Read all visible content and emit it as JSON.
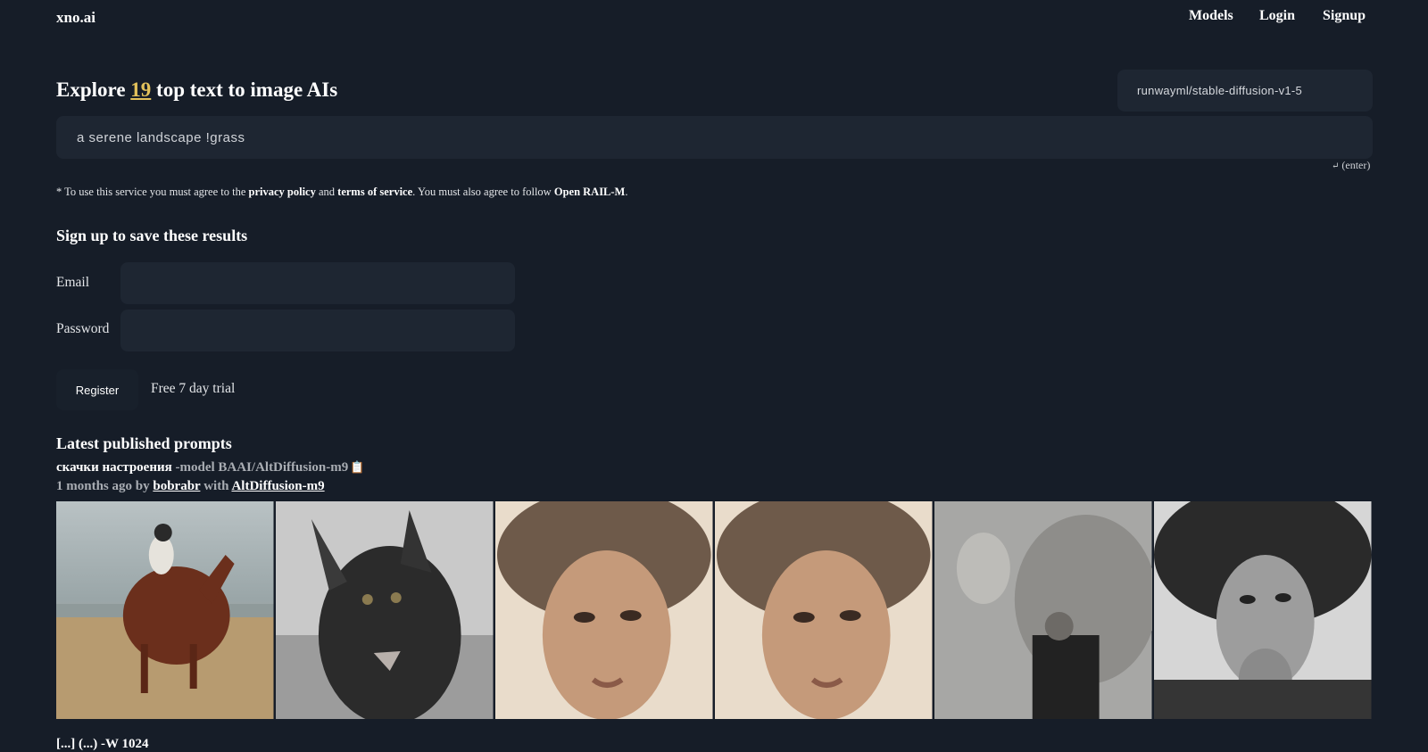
{
  "header": {
    "logo": "xno.ai",
    "nav": [
      "Models",
      "Login",
      "Signup"
    ]
  },
  "hero": {
    "explore_prefix": "Explore ",
    "model_count": "19",
    "explore_suffix": " top text to image AIs",
    "model_select_value": "runwayml/stable-diffusion-v1-5",
    "prompt_value": "a serene landscape !grass",
    "enter_hint": "(enter)"
  },
  "terms": {
    "t1": "* To use this service you must agree to the ",
    "privacy": "privacy policy",
    "t2": " and ",
    "tos": "terms of service",
    "t3": ". You must also agree to follow ",
    "rail": "Open RAIL-M",
    "t4": "."
  },
  "signup": {
    "title": "Sign up to save these results",
    "email_label": "Email",
    "password_label": "Password",
    "register_label": "Register",
    "trial_text": "Free 7 day trial"
  },
  "latest": {
    "title": "Latest published prompts",
    "prompt_text": "скачки настроения",
    "prompt_model": " -model BAAI/AltDiffusion-m9",
    "time_ago": "1 months ago by ",
    "author": "bobrabr",
    "with_text": " with ",
    "model_link": "AltDiffusion-m9",
    "images": [
      {
        "alt": "rider on horse at beach",
        "scene": "horse-beach"
      },
      {
        "alt": "dark furry wolf creature",
        "scene": "wolf"
      },
      {
        "alt": "woman portrait sepia",
        "scene": "woman"
      },
      {
        "alt": "woman portrait sepia duplicate",
        "scene": "woman"
      },
      {
        "alt": "man leaning on rock",
        "scene": "man-rock"
      },
      {
        "alt": "man with wild hair",
        "scene": "man-hair"
      }
    ],
    "next_prompt_partial": "[...] (...) -W 1024"
  },
  "colors": {
    "background": "#161d28",
    "input_bg": "#1e2632",
    "accent_count": "#e2c15b"
  },
  "icons": {
    "copy": "clipboard-icon",
    "enter": "enter-arrow-icon"
  }
}
